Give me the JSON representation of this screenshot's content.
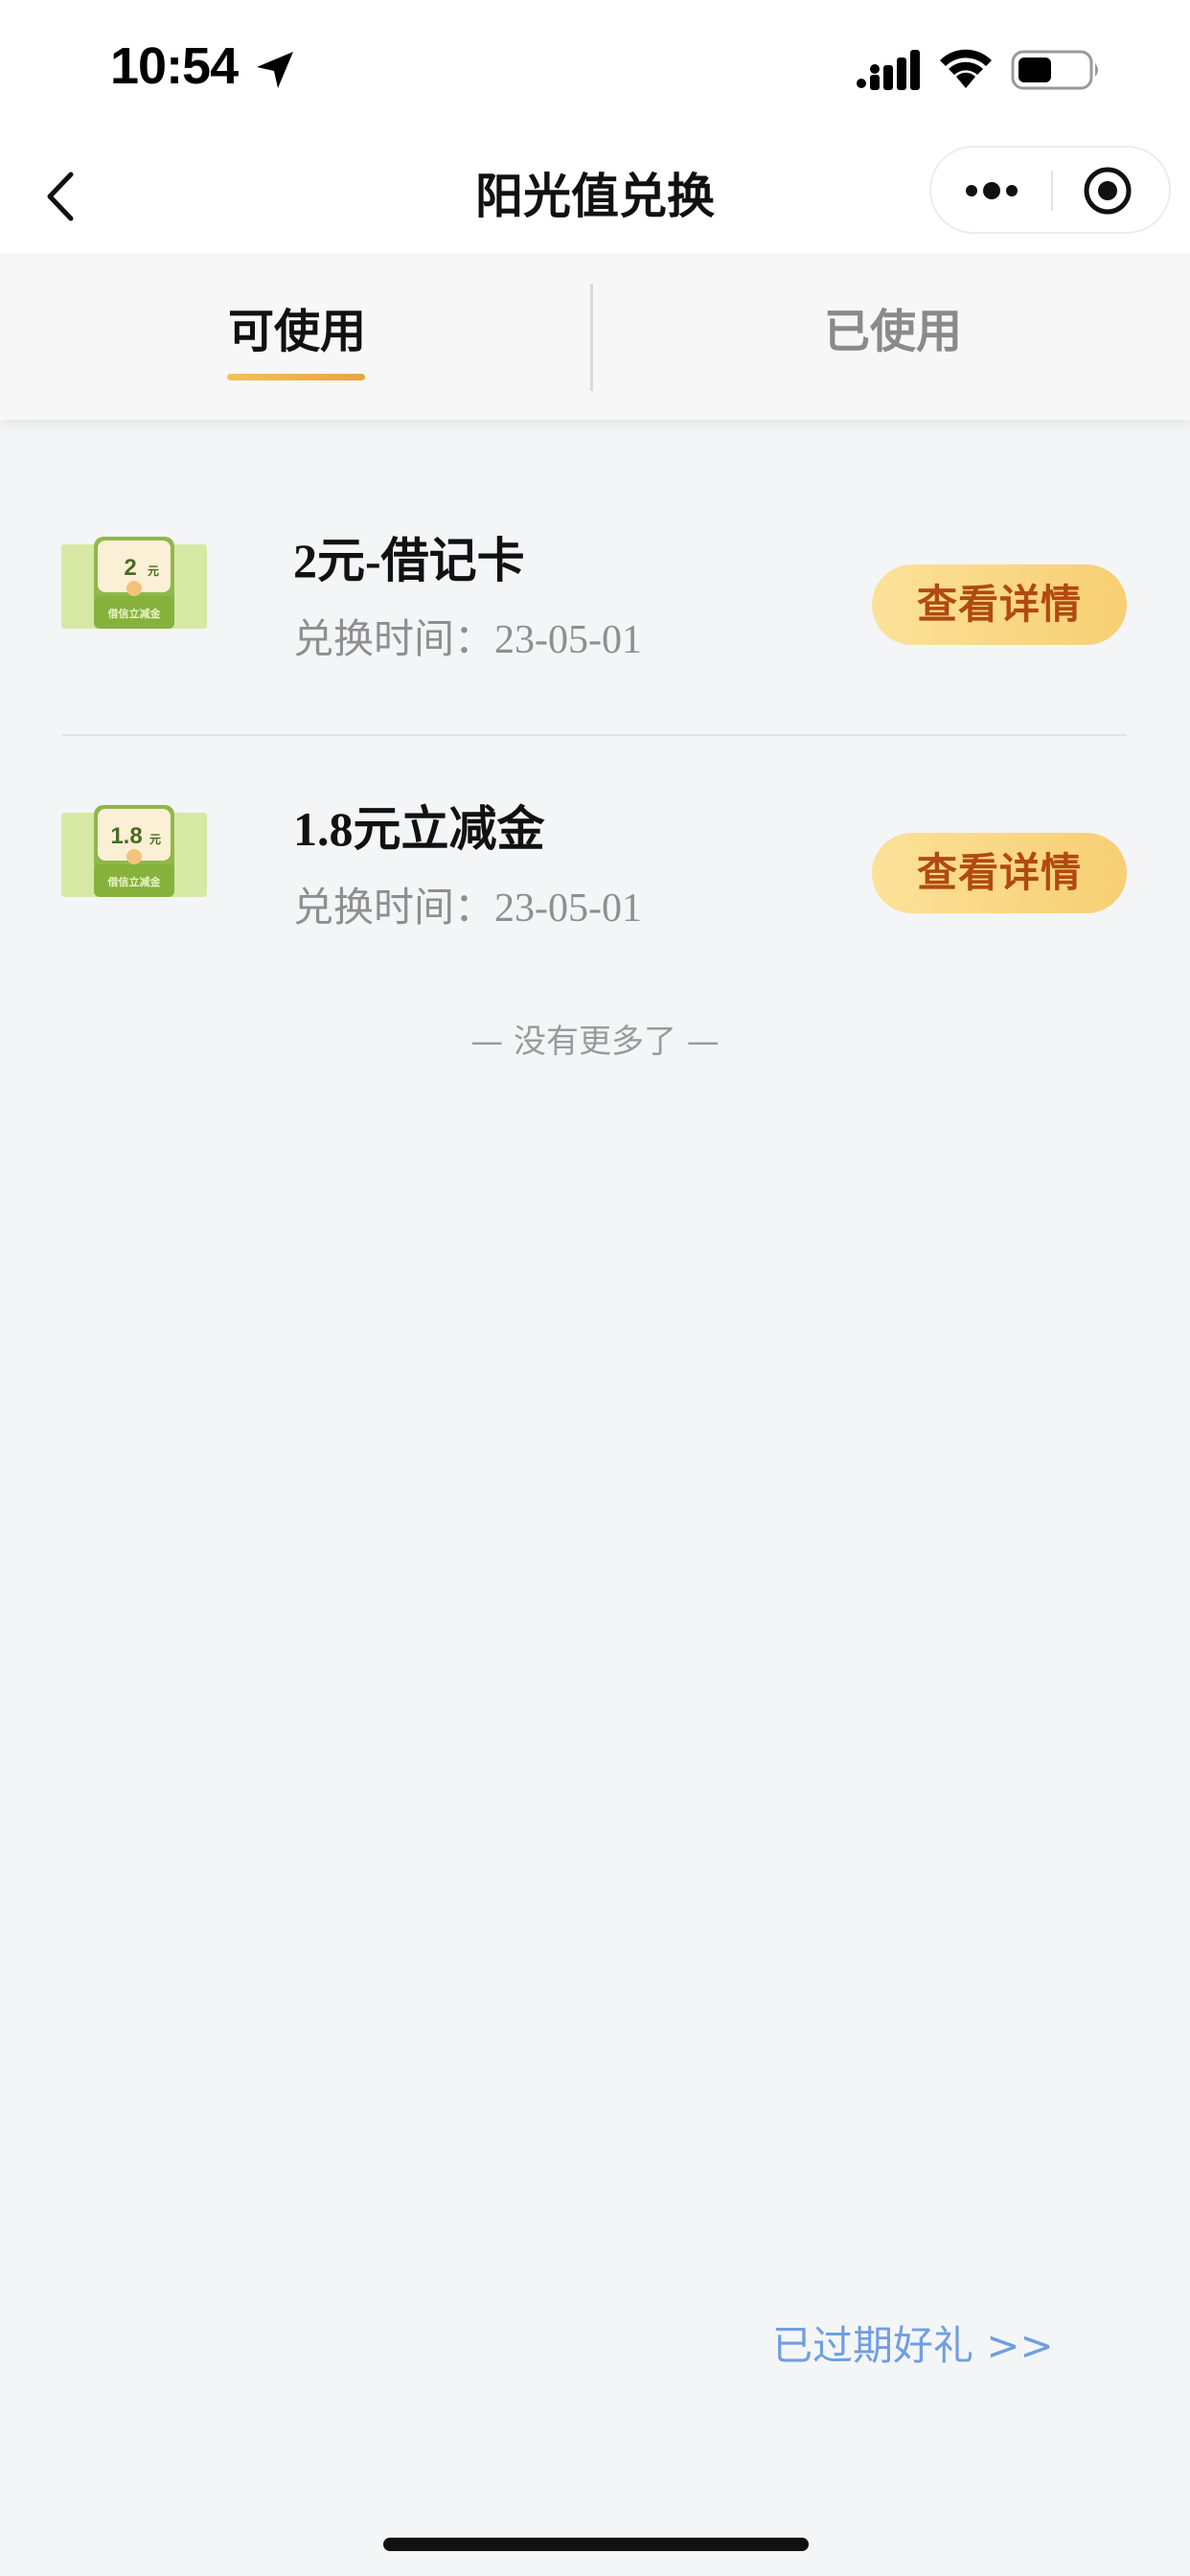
{
  "status_bar": {
    "time": "10:54"
  },
  "nav": {
    "title": "阳光值兑换"
  },
  "tabs": [
    {
      "label": "可使用",
      "active": true
    },
    {
      "label": "已使用",
      "active": false
    }
  ],
  "items": [
    {
      "title": "2元-借记卡",
      "time": "兑换时间：23-05-01",
      "button": "查看详情",
      "icon_amount": "2",
      "icon_unit": "元",
      "icon_caption": "借信立减金"
    },
    {
      "title": "1.8元立减金",
      "time": "兑换时间：23-05-01",
      "button": "查看详情",
      "icon_amount": "1.8",
      "icon_unit": "元",
      "icon_caption": "借信立减金"
    }
  ],
  "no_more": "— 没有更多了 —",
  "expired_link": "已过期好礼 >>",
  "colors": {
    "accent": "#e8a444",
    "button_text": "#b14a10",
    "link": "#6f9fe0",
    "background": "#f4f5f7"
  }
}
